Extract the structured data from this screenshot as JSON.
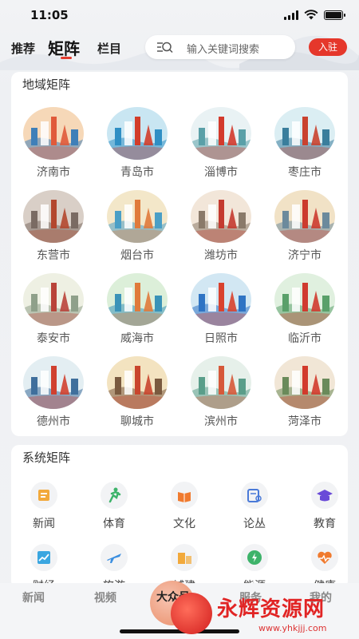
{
  "status_bar": {
    "time": "11:05"
  },
  "top_nav": {
    "tabs": [
      {
        "label": "推荐"
      },
      {
        "label": "矩阵"
      },
      {
        "label": "栏目"
      }
    ],
    "search_placeholder": "输入关键词搜索",
    "join_label": "入驻"
  },
  "region_section": {
    "title": "地域矩阵",
    "cities": [
      {
        "name": "济南市",
        "palette": [
          "#f6d8b8",
          "#e05a3a",
          "#3f7fb8"
        ]
      },
      {
        "name": "青岛市",
        "palette": [
          "#c9e6f2",
          "#d23d2a",
          "#2f8fc4"
        ]
      },
      {
        "name": "淄博市",
        "palette": [
          "#e9f2f4",
          "#d33a2c",
          "#5aa0a8"
        ]
      },
      {
        "name": "枣庄市",
        "palette": [
          "#dbeef3",
          "#c9422f",
          "#3a7e9c"
        ]
      },
      {
        "name": "东营市",
        "palette": [
          "#d9cfc7",
          "#b3472e",
          "#7a6b63"
        ]
      },
      {
        "name": "烟台市",
        "palette": [
          "#f3e7c9",
          "#e07a3b",
          "#4a9fc6"
        ]
      },
      {
        "name": "潍坊市",
        "palette": [
          "#f2e6d9",
          "#c43a2f",
          "#8a7a6a"
        ]
      },
      {
        "name": "济宁市",
        "palette": [
          "#f1e2c6",
          "#cc3b2d",
          "#6c8a9c"
        ]
      },
      {
        "name": "泰安市",
        "palette": [
          "#eef0e3",
          "#b9443a",
          "#8fa08a"
        ]
      },
      {
        "name": "威海市",
        "palette": [
          "#dcefd9",
          "#e07a3b",
          "#3a93b8"
        ]
      },
      {
        "name": "日照市",
        "palette": [
          "#d2e7f3",
          "#d9422e",
          "#2f74c4"
        ]
      },
      {
        "name": "临沂市",
        "palette": [
          "#e0f0df",
          "#d03b2f",
          "#5aa06a"
        ]
      },
      {
        "name": "德州市",
        "palette": [
          "#e3eef2",
          "#d0402f",
          "#3f6f9c"
        ]
      },
      {
        "name": "聊城市",
        "palette": [
          "#f3e3c0",
          "#c9452d",
          "#7a5a3f"
        ]
      },
      {
        "name": "滨州市",
        "palette": [
          "#e6f0ea",
          "#d6593a",
          "#5a9e8a"
        ]
      },
      {
        "name": "菏泽市",
        "palette": [
          "#f1e6d6",
          "#d23a2c",
          "#6a8a5a"
        ]
      }
    ]
  },
  "system_section": {
    "title": "系统矩阵",
    "items": [
      {
        "label": "新闻",
        "icon": "newspaper-icon",
        "color": "#f2a93b"
      },
      {
        "label": "体育",
        "icon": "runner-icon",
        "color": "#3db36a"
      },
      {
        "label": "文化",
        "icon": "book-icon",
        "color": "#f07a2e"
      },
      {
        "label": "论丛",
        "icon": "reading-icon",
        "color": "#4a7ad8"
      },
      {
        "label": "教育",
        "icon": "graduation-cap-icon",
        "color": "#6a4ad8"
      },
      {
        "label": "财经",
        "icon": "chart-icon",
        "color": "#3aa6e0"
      },
      {
        "label": "旅游",
        "icon": "airplane-icon",
        "color": "#3a8ee0"
      },
      {
        "label": "城建",
        "icon": "building-icon",
        "color": "#f2a93b"
      },
      {
        "label": "能源",
        "icon": "energy-icon",
        "color": "#3db36a"
      },
      {
        "label": "健康",
        "icon": "heartbeat-icon",
        "color": "#f07a2e"
      }
    ]
  },
  "bottom_bar": {
    "tabs": [
      {
        "label": "新闻"
      },
      {
        "label": "视频"
      },
      {
        "label": "大众号"
      },
      {
        "label": "服务"
      },
      {
        "label": "我的"
      }
    ]
  },
  "watermark": {
    "title": "永辉资源网",
    "url": "www.yhkjjj.com"
  }
}
